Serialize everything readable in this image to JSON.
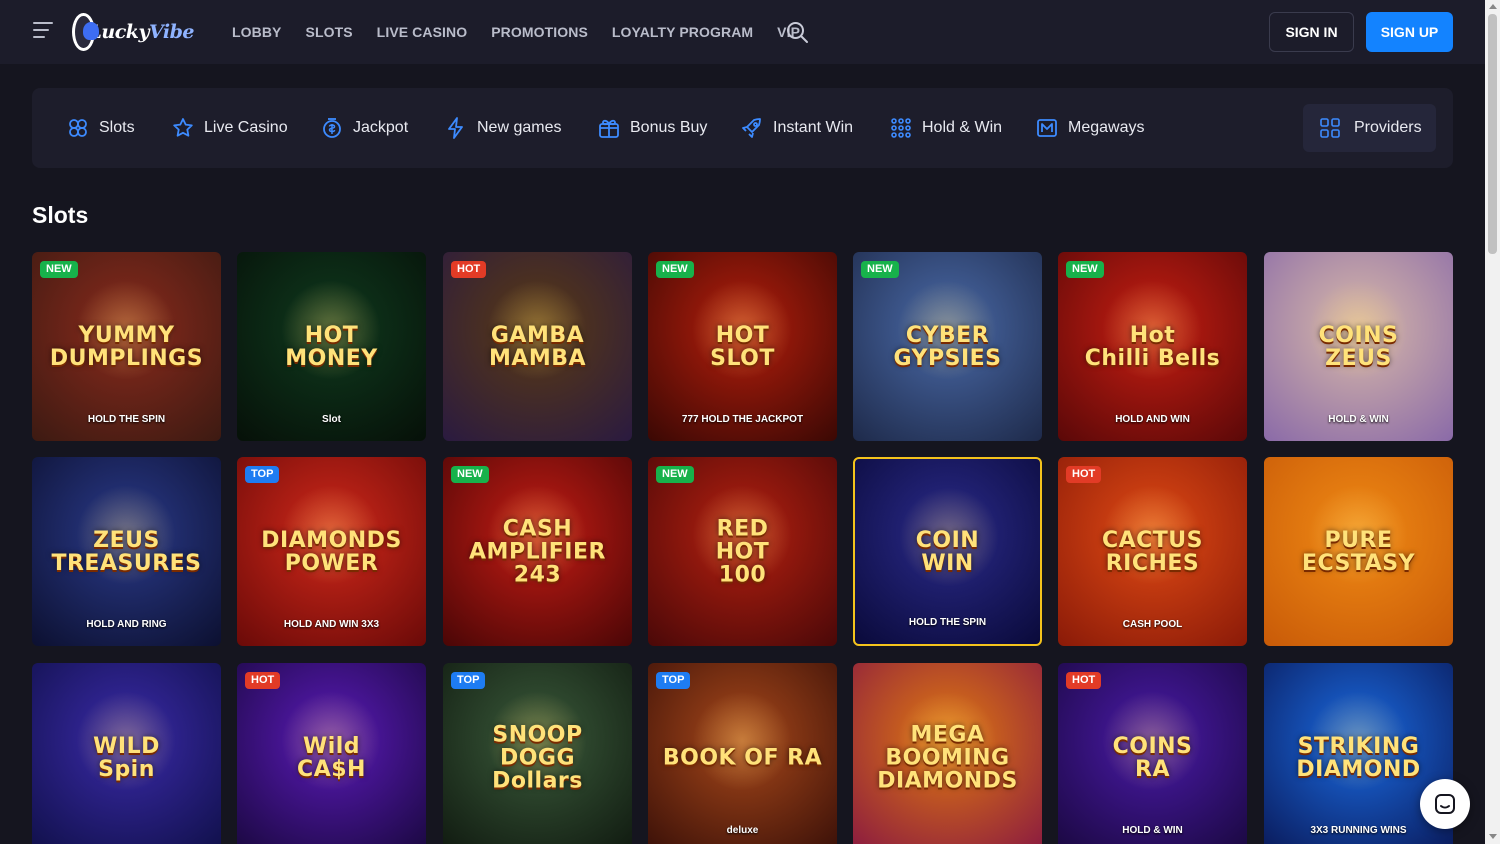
{
  "logo": {
    "text_main": "Lucky",
    "text_accent": "Vibe"
  },
  "nav": [
    {
      "label": "LOBBY"
    },
    {
      "label": "SLOTS"
    },
    {
      "label": "LIVE CASINO"
    },
    {
      "label": "PROMOTIONS"
    },
    {
      "label": "LOYALTY PROGRAM"
    },
    {
      "label": "VIP"
    }
  ],
  "auth": {
    "signin": "SIGN IN",
    "signup": "SIGN UP"
  },
  "categories": [
    {
      "label": "Slots",
      "icon": "slots-icon"
    },
    {
      "label": "Live Casino",
      "icon": "star-icon"
    },
    {
      "label": "Jackpot",
      "icon": "jackpot-coin-icon"
    },
    {
      "label": "New games",
      "icon": "lightning-icon"
    },
    {
      "label": "Bonus Buy",
      "icon": "gift-icon"
    },
    {
      "label": "Instant Win",
      "icon": "rocket-icon"
    },
    {
      "label": "Hold & Win",
      "icon": "grid-dots-icon"
    },
    {
      "label": "Megaways",
      "icon": "megaways-icon"
    }
  ],
  "providers_label": "Providers",
  "section_title": "Slots",
  "games": [
    {
      "title": "YUMMY\nDUMPLINGS",
      "subtitle": "HOLD THE SPIN",
      "badge": "NEW",
      "bg": "#8a2a1c",
      "bg2": "#3c1a12"
    },
    {
      "title": "HOT\nMONEY",
      "subtitle": "Slot",
      "badge": "",
      "bg": "#0f3a1e",
      "bg2": "#061008"
    },
    {
      "title": "GAMBA\nMAMBA",
      "subtitle": "",
      "badge": "HOT",
      "bg": "#5a3a12",
      "bg2": "#2a1a40"
    },
    {
      "title": "HOT\nSLOT",
      "subtitle": "777 HOLD THE JACKPOT",
      "badge": "NEW",
      "bg": "#b51e0c",
      "bg2": "#3a0804"
    },
    {
      "title": "CYBER\nGYPSIES",
      "subtitle": "",
      "badge": "NEW",
      "bg": "#4a6aa8",
      "bg2": "#1e2a4a"
    },
    {
      "title": "Hot\nChilli Bells",
      "subtitle": "HOLD AND WIN",
      "badge": "NEW",
      "bg": "#c71e12",
      "bg2": "#5a0808"
    },
    {
      "title": "COINS\nZEUS",
      "subtitle": "HOLD & WIN",
      "badge": "",
      "bg": "#d8b9a8",
      "bg2": "#8a6aa8"
    },
    {
      "title": "ZEUS\nTREASURES",
      "subtitle": "HOLD AND RING",
      "badge": "",
      "bg": "#2a3a8a",
      "bg2": "#0c1030"
    },
    {
      "title": "DIAMONDS\nPOWER",
      "subtitle": "HOLD AND WIN 3X3",
      "badge": "TOP",
      "bg": "#d0281a",
      "bg2": "#6a0a08"
    },
    {
      "title": "CASH\nAMPLIFIER 243",
      "subtitle": "",
      "badge": "NEW",
      "bg": "#c41c14",
      "bg2": "#4a0606"
    },
    {
      "title": "RED\nHOT\n100",
      "subtitle": "",
      "badge": "NEW",
      "bg": "#b52010",
      "bg2": "#4a0808"
    },
    {
      "title": "COIN\nWIN",
      "subtitle": "HOLD THE SPIN",
      "badge": "",
      "bg": "#2a2a8a",
      "bg2": "#0a0a3a"
    },
    {
      "title": "CACTUS\nRICHES",
      "subtitle": "CASH POOL",
      "badge": "HOT",
      "bg": "#e04a14",
      "bg2": "#8a1a08"
    },
    {
      "title": "PURE\nECSTASY",
      "subtitle": "",
      "badge": "",
      "bg": "#f08a14",
      "bg2": "#c85a08"
    },
    {
      "title": "WILD\nSpin",
      "subtitle": "",
      "badge": "",
      "bg": "#3a2aa8",
      "bg2": "#10104a"
    },
    {
      "title": "Wild\nCA$H",
      "subtitle": "",
      "badge": "HOT",
      "bg": "#5a1ab8",
      "bg2": "#1a0840"
    },
    {
      "title": "SNOOP\nDOGG\nDollars",
      "subtitle": "",
      "badge": "TOP",
      "bg": "#3a5a3a",
      "bg2": "#101a10"
    },
    {
      "title": "BOOK OF RA",
      "subtitle": "deluxe",
      "badge": "TOP",
      "bg": "#a8481a",
      "bg2": "#3a1008"
    },
    {
      "title": "MEGA BOOMING\nDIAMONDS",
      "subtitle": "",
      "badge": "",
      "bg": "#e07a10",
      "bg2": "#8a1a40"
    },
    {
      "title": "COINS\nRA",
      "subtitle": "HOLD & WIN",
      "badge": "HOT",
      "bg": "#4a1aa8",
      "bg2": "#1a0840"
    },
    {
      "title": "STRIKING\nDIAMOND",
      "subtitle": "3X3 RUNNING WINS",
      "badge": "",
      "bg": "#1a6ae0",
      "bg2": "#0a1a5a"
    }
  ]
}
